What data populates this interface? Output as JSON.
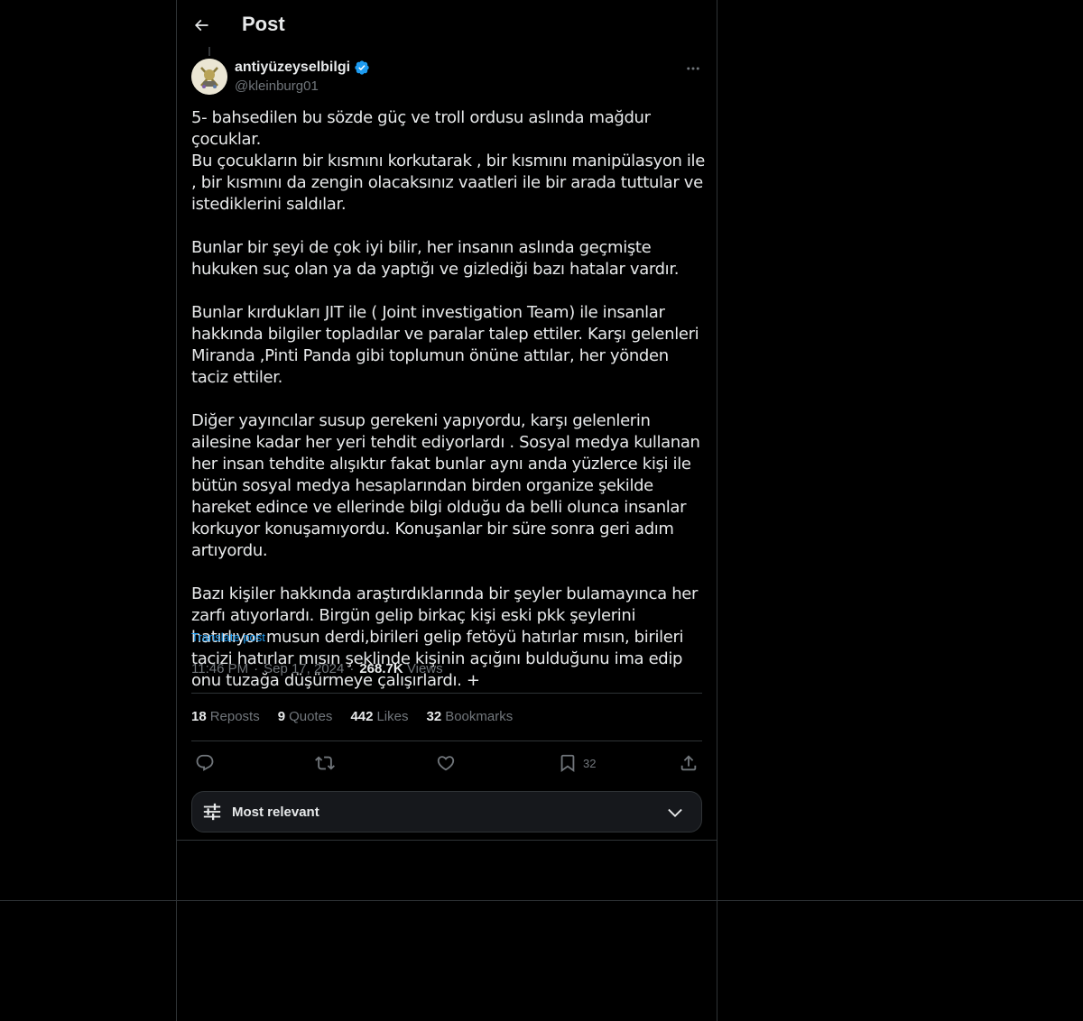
{
  "header": {
    "title": "Post"
  },
  "author": {
    "display_name": "antiyüzeyselbilgi",
    "handle": "@kleinburg01",
    "verified": true
  },
  "post": {
    "paragraphs": [
      "5- bahsedilen bu sözde güç ve troll ordusu aslında mağdur çocuklar.\nBu çocukların bir kısmını korkutarak , bir kısmını manipülasyon ile , bir kısmını da zengin olacaksınız vaatleri ile bir arada tuttular ve istediklerini saldılar.",
      "Bunlar bir şeyi de çok iyi bilir, her insanın aslında geçmişte hukuken suç olan ya da yaptığı ve gizlediği bazı hatalar vardır.",
      "Bunlar kırdukları JIT ile ( Joint investigation Team) ile insanlar hakkında bilgiler topladılar ve paralar talep ettiler. Karşı gelenleri Miranda ,Pinti Panda gibi toplumun önüne attılar, her yönden taciz ettiler.",
      "Diğer yayıncılar susup gerekeni yapıyordu, karşı gelenlerin ailesine kadar her yeri tehdit ediyorlardı . Sosyal medya kullanan her insan tehdite alışıktır fakat bunlar aynı anda yüzlerce kişi ile bütün sosyal medya hesaplarından birden organize şekilde hareket edince ve ellerinde bilgi olduğu da belli olunca insanlar korkuyor konuşamıyordu. Konuşanlar bir süre sonra geri adım artıyordu.",
      "Bazı kişiler hakkında araştırdıklarında bir şeyler bulamayınca her zarfı atıyorlardı. Birgün gelip birkaç kişi eski pkk şeylerini hatırlıyor musun derdi,birileri gelip fetöyü hatırlar mısın, birileri tacizi hatırlar mısın şeklinde kişinin açığını bulduğunu ima edip onu tuzağa düşürmeye çalışırlardı. +"
    ],
    "translate_label": "Translate post",
    "time": "11:46 PM",
    "date": "Sep 17, 2024",
    "views_count": "268.7K",
    "views_label": "Views",
    "dot": "·"
  },
  "stats": {
    "reposts": {
      "count": "18",
      "label": "Reposts"
    },
    "quotes": {
      "count": "9",
      "label": "Quotes"
    },
    "likes": {
      "count": "442",
      "label": "Likes"
    },
    "bookmarks": {
      "count": "32",
      "label": "Bookmarks"
    }
  },
  "actions": {
    "bookmark_count": "32"
  },
  "replies_sort": {
    "label": "Most relevant"
  },
  "icons": {
    "back": "arrow-left-icon",
    "verified": "verified-badge-icon",
    "more": "more-horizontal-icon",
    "reply": "reply-icon",
    "repost": "repost-icon",
    "like": "heart-icon",
    "bookmark": "bookmark-icon",
    "share": "share-icon",
    "sort": "sliders-icon",
    "chevron": "chevron-down-icon"
  },
  "colors": {
    "background": "#000000",
    "text": "#e7e9ea",
    "secondary_text": "#71767b",
    "accent": "#1d9bf0",
    "border": "#2f3336"
  }
}
